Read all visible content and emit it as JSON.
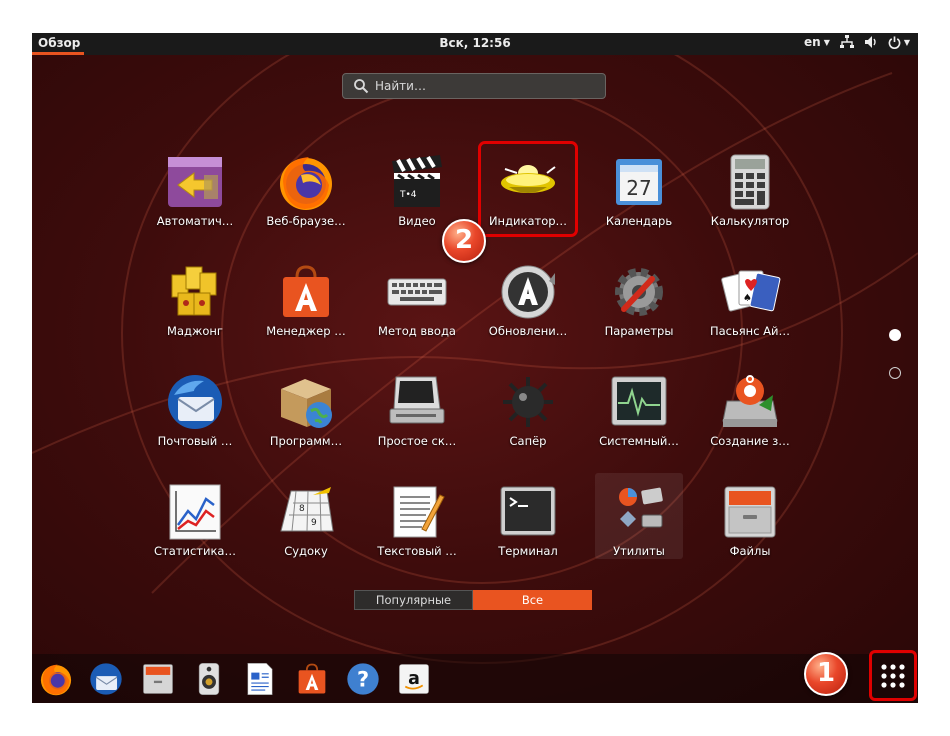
{
  "topbar": {
    "activities": "Обзор",
    "clock": "Вск, 12:56",
    "language": "en"
  },
  "search": {
    "placeholder": "Найти…"
  },
  "apps": [
    {
      "label": "Автоматич…",
      "icon": "software-updater-icon"
    },
    {
      "label": "Веб-браузе…",
      "icon": "firefox-icon"
    },
    {
      "label": "Видео",
      "icon": "video-clapper-icon"
    },
    {
      "label": "Индикатор…",
      "icon": "ufo-indicator-icon"
    },
    {
      "label": "Календарь",
      "icon": "calendar-icon"
    },
    {
      "label": "Калькулятор",
      "icon": "calculator-icon"
    },
    {
      "label": "Маджонг",
      "icon": "mahjongg-icon"
    },
    {
      "label": "Менеджер …",
      "icon": "software-bag-icon"
    },
    {
      "label": "Метод ввода",
      "icon": "keyboard-icon"
    },
    {
      "label": "Обновлени…",
      "icon": "update-icon"
    },
    {
      "label": "Параметры",
      "icon": "settings-gear-icon"
    },
    {
      "label": "Пасьянс Ай…",
      "icon": "solitaire-cards-icon"
    },
    {
      "label": "Почтовый …",
      "icon": "thunderbird-icon"
    },
    {
      "label": "Программ…",
      "icon": "package-globe-icon"
    },
    {
      "label": "Простое ск…",
      "icon": "scanner-icon"
    },
    {
      "label": "Сапёр",
      "icon": "mine-icon"
    },
    {
      "label": "Системный…",
      "icon": "system-monitor-icon"
    },
    {
      "label": "Создание з…",
      "icon": "startup-disk-icon"
    },
    {
      "label": "Статистика…",
      "icon": "statistics-chart-icon"
    },
    {
      "label": "Судоку",
      "icon": "sudoku-icon"
    },
    {
      "label": "Текстовый …",
      "icon": "text-editor-icon"
    },
    {
      "label": "Терминал",
      "icon": "terminal-icon"
    },
    {
      "label": "Утилиты",
      "icon": "utilities-folder-icon"
    },
    {
      "label": "Файлы",
      "icon": "files-cabinet-icon"
    }
  ],
  "switcher": {
    "popular": "Популярные",
    "all": "Все",
    "active": "all"
  },
  "badges": {
    "one": "1",
    "two": "2"
  },
  "dock": [
    {
      "name": "dock-firefox",
      "icon": "firefox-icon"
    },
    {
      "name": "dock-thunderbird",
      "icon": "thunderbird-icon"
    },
    {
      "name": "dock-files",
      "icon": "files-cabinet-icon"
    },
    {
      "name": "dock-rhythmbox",
      "icon": "speaker-icon"
    },
    {
      "name": "dock-libreoffice-writer",
      "icon": "writer-document-icon"
    },
    {
      "name": "dock-software",
      "icon": "software-bag-icon"
    },
    {
      "name": "dock-help",
      "icon": "help-icon"
    },
    {
      "name": "dock-amazon",
      "icon": "amazon-icon"
    }
  ],
  "colors": {
    "accent": "#e95420",
    "highlight": "#e00000",
    "topbar": "#1a1a1a"
  }
}
